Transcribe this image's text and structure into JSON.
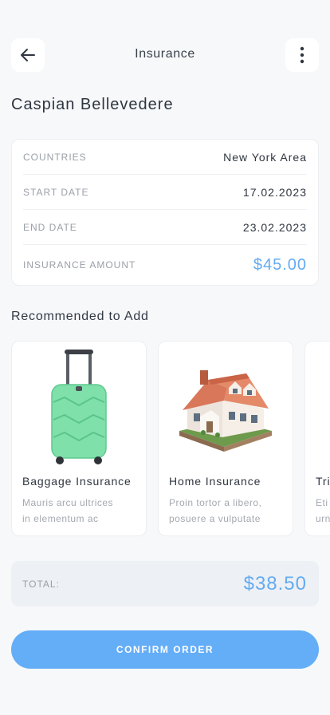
{
  "header": {
    "title": "Insurance",
    "back_icon": "arrow-left-icon",
    "more_icon": "more-vertical-icon"
  },
  "person": {
    "name": "Caspian Bellevedere"
  },
  "details": [
    {
      "label": "COUNTRIES",
      "value": "New York Area"
    },
    {
      "label": "START DATE",
      "value": "17.02.2023"
    },
    {
      "label": "END DATE",
      "value": "23.02.2023"
    },
    {
      "label": "INSURANCE AMOUNT",
      "value": "$45.00"
    }
  ],
  "recommended": {
    "title": "Recommended to Add",
    "items": [
      {
        "title": "Baggage Insurance",
        "description": "Mauris arcu ultrices\nin elementum ac",
        "image": "suitcase-image"
      },
      {
        "title": "Home Insurance",
        "description": "Proin tortor a libero,\nposuere a vulputate",
        "image": "house-image"
      },
      {
        "title": "Tri",
        "description": "Eti\nurn",
        "image": ""
      }
    ]
  },
  "total": {
    "label": "TOTAL:",
    "value": "$38.50"
  },
  "confirm": {
    "label": "CONFIRM ORDER"
  },
  "colors": {
    "accent": "#64abf0",
    "button": "#64adf7",
    "background": "#f7f8fa",
    "suitcase": "#7fe0aa"
  }
}
